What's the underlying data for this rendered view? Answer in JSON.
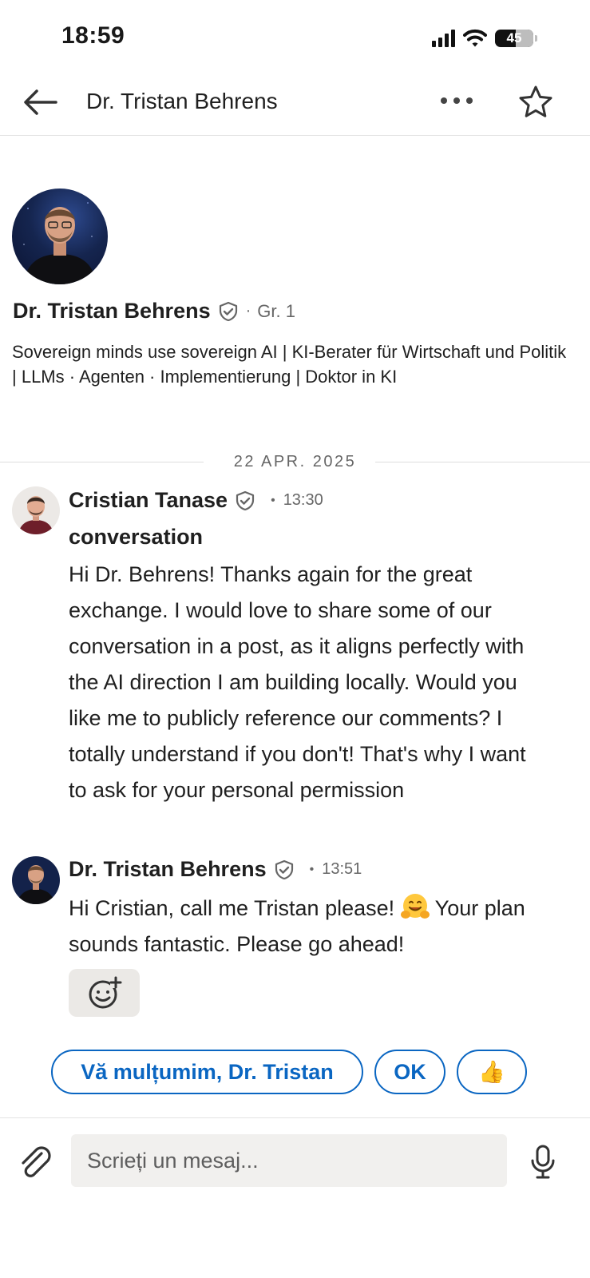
{
  "status_bar": {
    "time": "18:59",
    "battery": "45"
  },
  "header": {
    "title": "Dr. Tristan Behrens",
    "back_icon": "arrow-left-icon",
    "more_icon": "more-horizontal-icon",
    "star_icon": "star-outline-icon"
  },
  "profile": {
    "name": "Dr. Tristan Behrens",
    "degree": "Gr. 1",
    "headline": "Sovereign minds use sovereign AI | KI-Berater für Wirtschaft und Politik | LLMs · Agenten · Implementierung | Doktor in KI"
  },
  "date_separator": "22 APR. 2025",
  "messages": [
    {
      "sender": "Cristian Tanase",
      "time": "13:30",
      "subject": "conversation",
      "body": "Hi Dr. Behrens! Thanks again for the great exchange. I would love to share some of our conversation in a post, as it aligns perfectly with the AI direction I am building locally. Would you like me to publicly reference our comments? I totally understand if you don't! That's why I want to ask for your personal permission"
    },
    {
      "sender": "Dr. Tristan Behrens",
      "time": "13:51",
      "body_before": "Hi Cristian, call me Tristan please!",
      "body_after": "Your plan sounds fantastic. Please go ahead!",
      "inline_emoji": "hugging-face-emoji"
    }
  ],
  "react_icon": "add-reaction-icon",
  "quick_replies": [
    "Vă mulțumim, Dr. Tristan",
    "OK",
    "👍"
  ],
  "composer": {
    "placeholder": "Scrieți un mesaj...",
    "attach_icon": "paperclip-icon",
    "mic_icon": "microphone-icon"
  },
  "colors": {
    "accent": "#0a66c2",
    "text": "#1f1f1f",
    "muted": "#666666"
  }
}
